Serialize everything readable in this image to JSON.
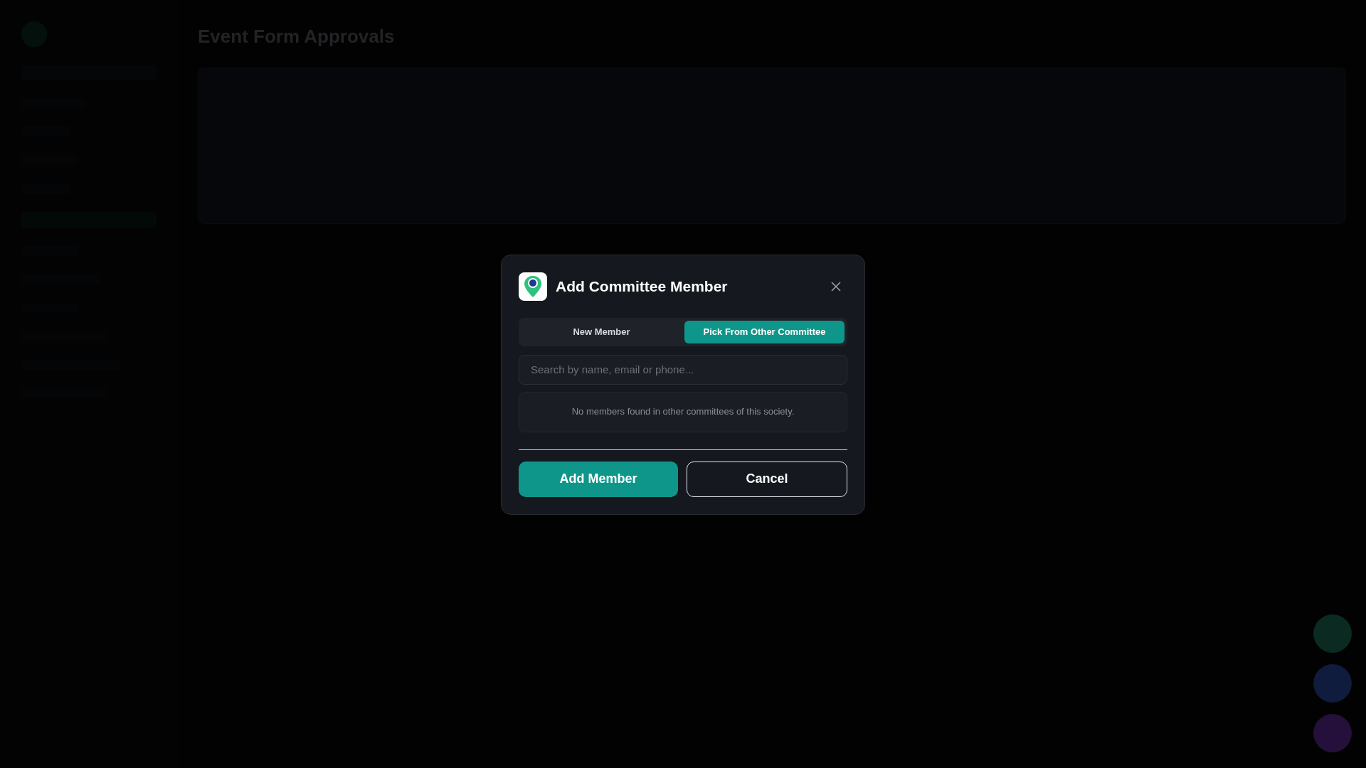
{
  "background": {
    "page_title": "Event Form Approvals"
  },
  "dialog": {
    "title": "Add Committee Member",
    "tabs": [
      {
        "label": "New Member",
        "selected": false
      },
      {
        "label": "Pick From Other Committee",
        "selected": true
      }
    ],
    "search": {
      "placeholder": "Search by name, email or phone..."
    },
    "empty_message": "No members found in other committees of this society.",
    "buttons": [
      {
        "label": "Add Member",
        "kind": "primary"
      },
      {
        "label": "Cancel",
        "kind": "secondary"
      }
    ]
  }
}
